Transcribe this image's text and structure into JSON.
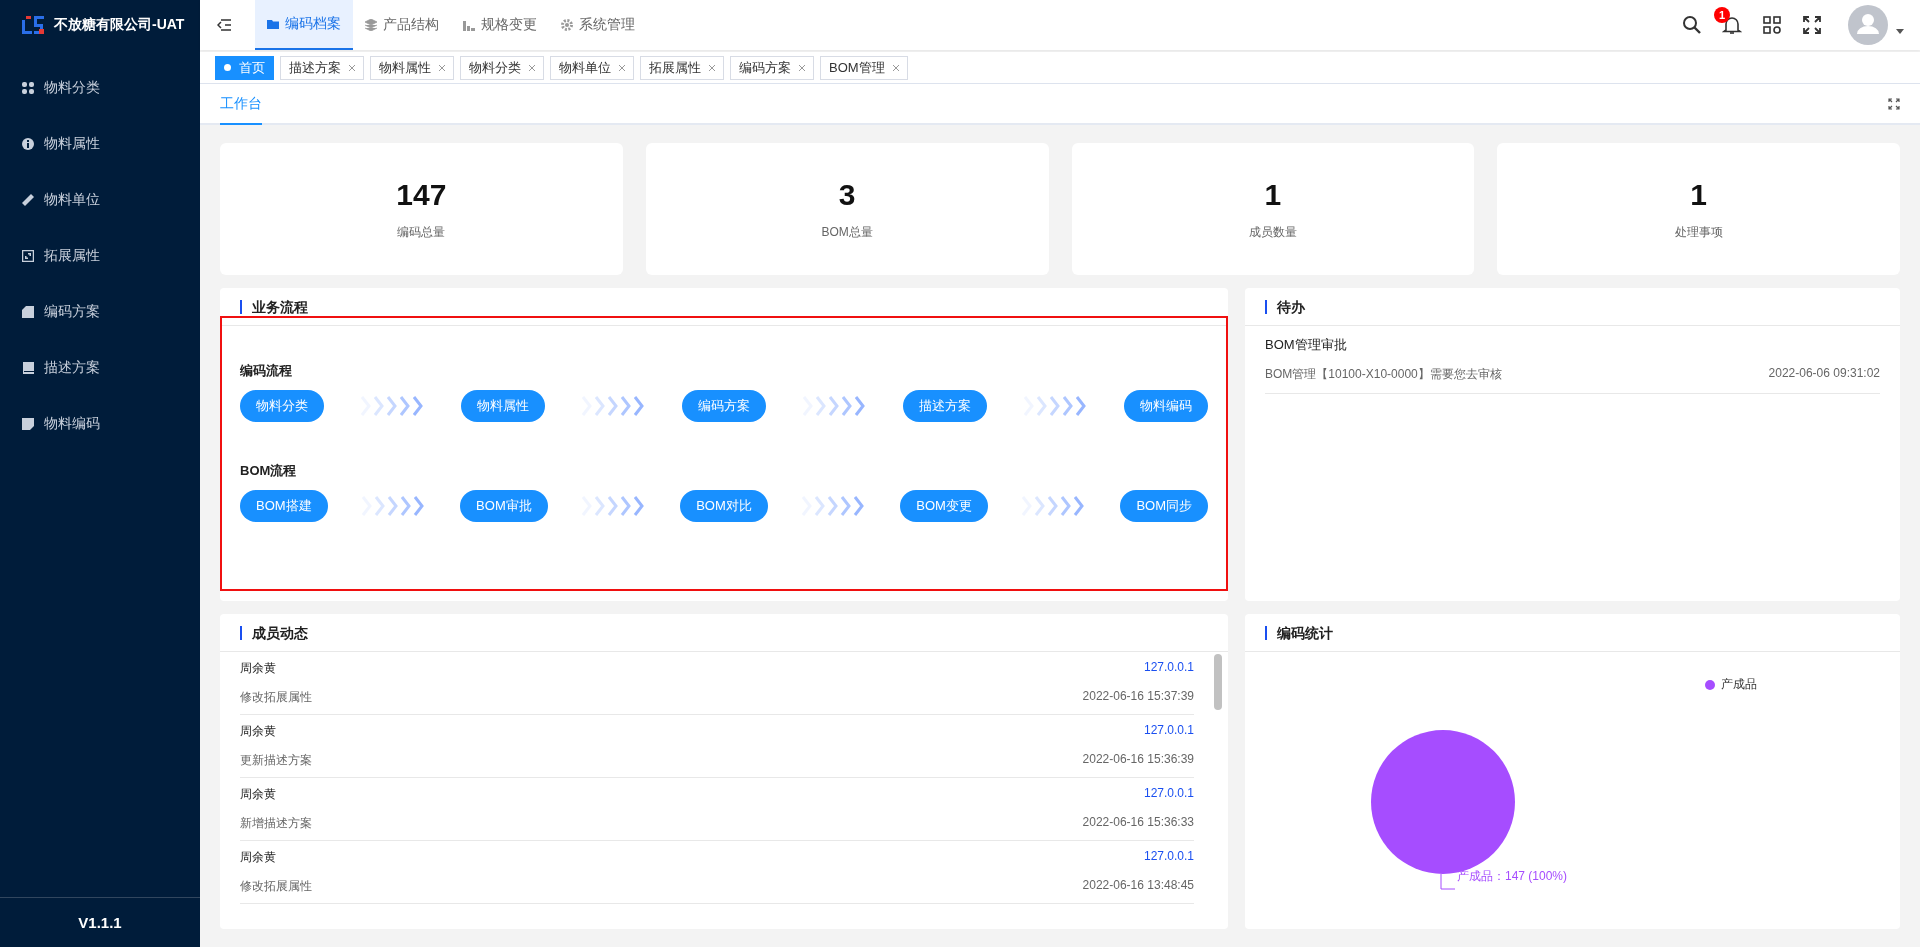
{
  "brand": {
    "name": "不放糖有限公司-UAT"
  },
  "sidebar": {
    "items": [
      {
        "label": "物料分类"
      },
      {
        "label": "物料属性"
      },
      {
        "label": "物料单位"
      },
      {
        "label": "拓展属性"
      },
      {
        "label": "编码方案"
      },
      {
        "label": "描述方案"
      },
      {
        "label": "物料编码"
      }
    ],
    "version": "V1.1.1"
  },
  "top_nav": {
    "items": [
      {
        "label": "编码档案",
        "selected": true
      },
      {
        "label": "产品结构",
        "selected": false
      },
      {
        "label": "规格变更",
        "selected": false
      },
      {
        "label": "系统管理",
        "selected": false
      }
    ]
  },
  "header": {
    "notification_count": "1"
  },
  "open_tabs": [
    {
      "label": "首页",
      "selected": true,
      "closable": false
    },
    {
      "label": "描述方案",
      "selected": false,
      "closable": true
    },
    {
      "label": "物料属性",
      "selected": false,
      "closable": true
    },
    {
      "label": "物料分类",
      "selected": false,
      "closable": true
    },
    {
      "label": "物料单位",
      "selected": false,
      "closable": true
    },
    {
      "label": "拓展属性",
      "selected": false,
      "closable": true
    },
    {
      "label": "编码方案",
      "selected": false,
      "closable": true
    },
    {
      "label": "BOM管理",
      "selected": false,
      "closable": true
    }
  ],
  "page_tabs": [
    {
      "label": "工作台",
      "selected": true
    }
  ],
  "stats": [
    {
      "value": "147",
      "label": "编码总量"
    },
    {
      "value": "3",
      "label": "BOM总量"
    },
    {
      "value": "1",
      "label": "成员数量"
    },
    {
      "value": "1",
      "label": "处理事项"
    }
  ],
  "workflow": {
    "title": "业务流程",
    "highlighted": true,
    "flows": [
      {
        "title": "编码流程",
        "steps": [
          "物料分类",
          "物料属性",
          "编码方案",
          "描述方案",
          "物料编码"
        ]
      },
      {
        "title": "BOM流程",
        "steps": [
          "BOM搭建",
          "BOM审批",
          "BOM对比",
          "BOM变更",
          "BOM同步"
        ]
      }
    ]
  },
  "todo": {
    "title": "待办",
    "items": [
      {
        "title": "BOM管理审批",
        "description": "BOM管理【10100-X10-0000】需要您去审核",
        "time": "2022-06-06 09:31:02"
      }
    ]
  },
  "activity": {
    "title": "成员动态",
    "items": [
      {
        "user": "周余黄",
        "ip": "127.0.0.1",
        "action": "修改拓展属性",
        "time": "2022-06-16 15:37:39"
      },
      {
        "user": "周余黄",
        "ip": "127.0.0.1",
        "action": "更新描述方案",
        "time": "2022-06-16 15:36:39"
      },
      {
        "user": "周余黄",
        "ip": "127.0.0.1",
        "action": "新增描述方案",
        "time": "2022-06-16 15:36:33"
      },
      {
        "user": "周余黄",
        "ip": "127.0.0.1",
        "action": "修改拓展属性",
        "time": "2022-06-16 13:48:45"
      }
    ]
  },
  "code_stats": {
    "title": "编码统计",
    "legend": [
      {
        "label": "产成品",
        "color": "#a64dff"
      }
    ],
    "slice_label": "产成品：147 (100%)"
  }
}
